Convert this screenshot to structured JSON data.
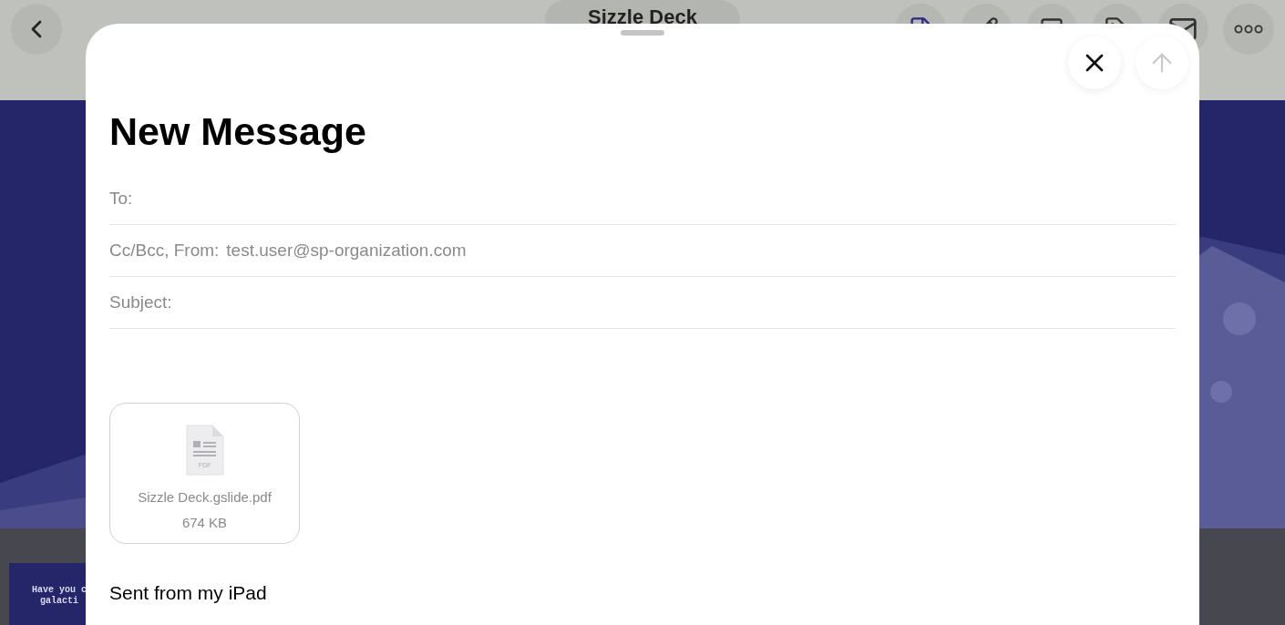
{
  "document": {
    "title": "Sizzle Deck",
    "thumbnail_lines": [
      "Have you c",
      "galacti"
    ]
  },
  "message": {
    "title": "New Message",
    "fields": [
      {
        "label": "To:"
      },
      {
        "label": "Cc/Bcc, From:",
        "value": "test.user@sp-organization.com"
      },
      {
        "label": "Subject:"
      }
    ],
    "attachment": {
      "name": "Sizzle Deck.gslide.pdf",
      "size": "674 KB",
      "type": "PDF"
    },
    "signature": "Sent from my iPad",
    "send_enabled": false
  }
}
